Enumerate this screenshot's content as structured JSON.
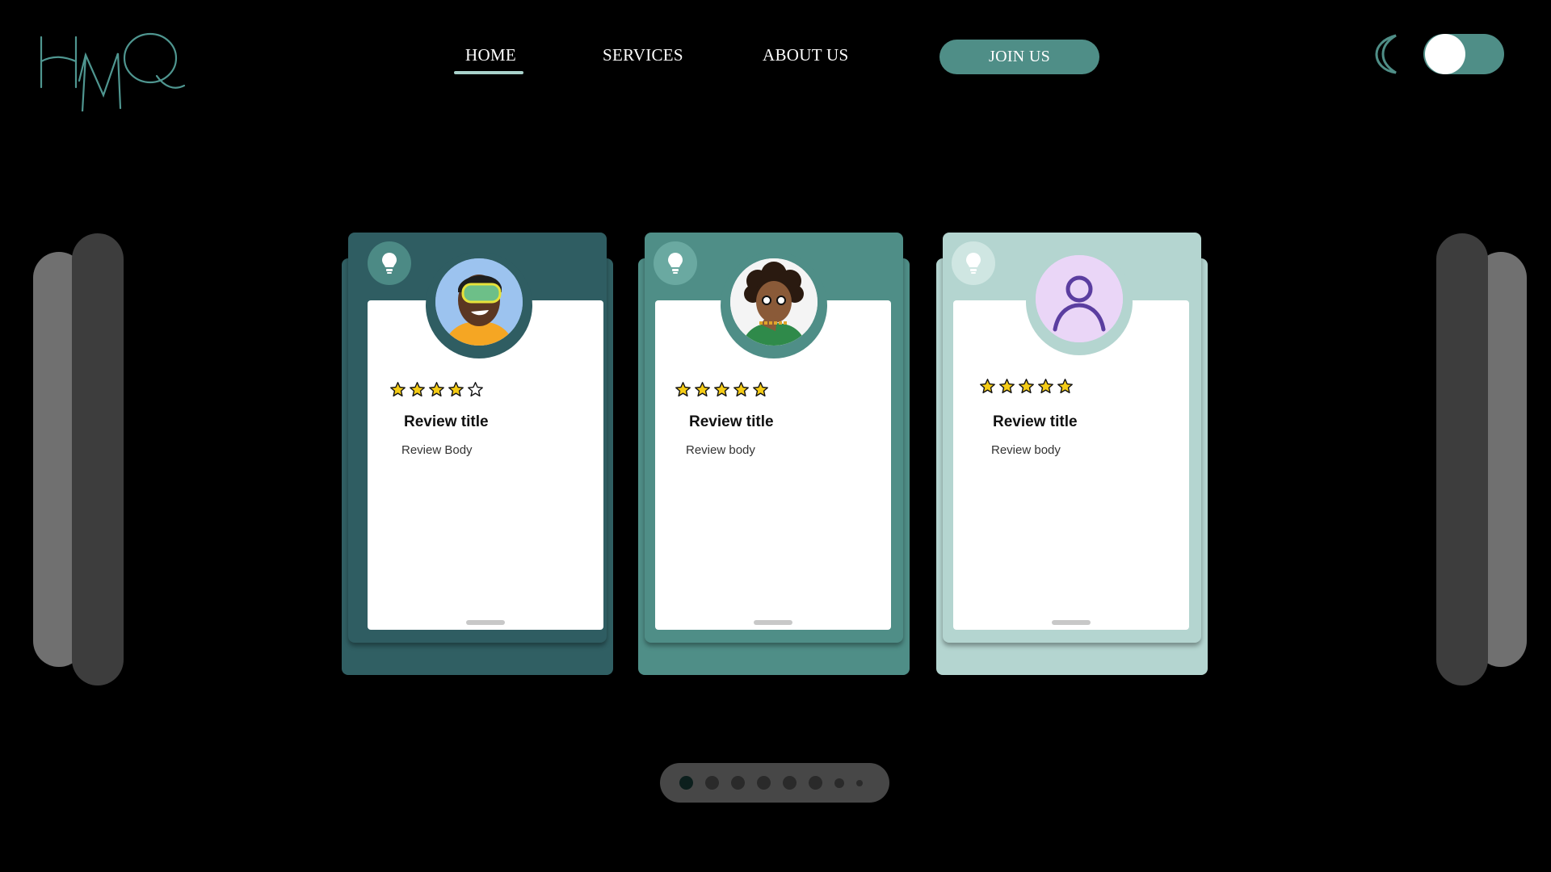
{
  "brand": {
    "logo_text": "HMQ",
    "accent": "#4f8e87"
  },
  "nav": {
    "home": "HOME",
    "services": "SERVICES",
    "about": "ABOUT US",
    "join": "JOIN US"
  },
  "theme_toggle": {
    "icon": "moon-icon",
    "state": "on"
  },
  "cards": [
    {
      "stars": 4,
      "title": "Review title",
      "body": "Review Body",
      "color_back": "#305f63",
      "color_front": "#2f5d62",
      "avatar": "vr-headset-person"
    },
    {
      "stars": 5,
      "title": "Review title",
      "body": "Review body",
      "color_back": "#4f8e87",
      "color_front": "#4f8e87",
      "avatar": "curly-hair-person"
    },
    {
      "stars": 5,
      "title": "Review title",
      "body": "Review body",
      "color_back": "#b4d5d0",
      "color_front": "#b4d5d0",
      "avatar": "default-user-avatar"
    }
  ],
  "pagination": {
    "count": 8,
    "active": 1
  }
}
